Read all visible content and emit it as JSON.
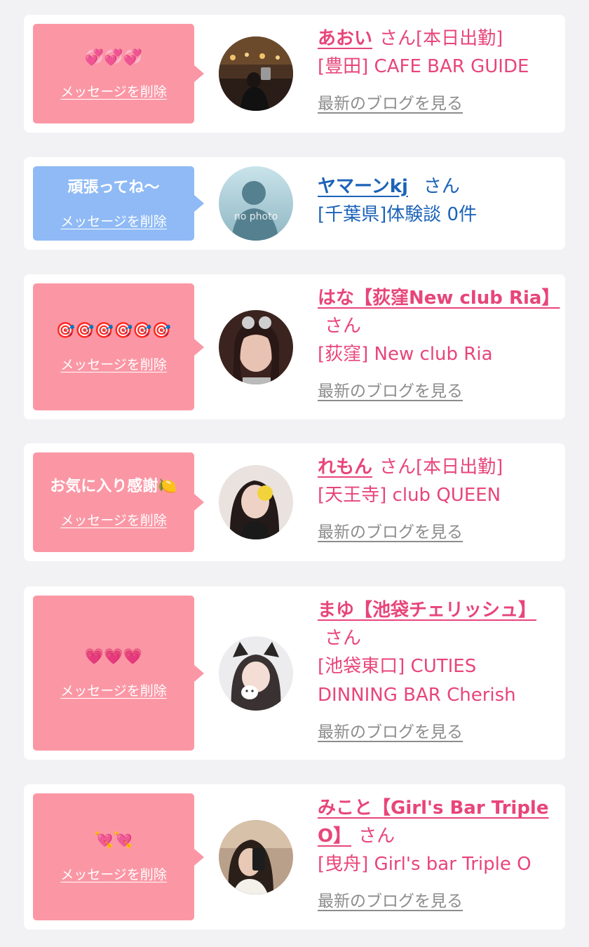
{
  "cards": [
    {
      "message": "💞💞💞",
      "delete_label": "メッセージを削除",
      "name": "あおい",
      "honorific": "さん",
      "status": "[本日出勤]",
      "shop": "[豊田] CAFE BAR GUIDE",
      "blog_link": "最新のブログを見る"
    },
    {
      "message": "頑張ってね〜",
      "delete_label": "メッセージを削除",
      "name": "ヤマーンkj",
      "honorific": "さん",
      "shop": "[千葉県]体験談 0件",
      "avatar_label": "no photo"
    },
    {
      "message": "🎯🎯🎯🎯🎯🎯",
      "delete_label": "メッセージを削除",
      "name": "はな【荻窪New club Ria】",
      "honorific": "さん",
      "shop": "[荻窪] New club Ria",
      "blog_link": "最新のブログを見る"
    },
    {
      "message": "お気に入り感謝🍋",
      "delete_label": "メッセージを削除",
      "name": "れもん",
      "honorific": "さん",
      "status": "[本日出勤]",
      "shop": "[天王寺] club QUEEN",
      "blog_link": "最新のブログを見る"
    },
    {
      "message": "💗💗💗",
      "delete_label": "メッセージを削除",
      "name": "まゆ【池袋チェリッシュ】",
      "honorific": "さん",
      "shop": "[池袋東口] CUTIES DINNING BAR Cherish",
      "blog_link": "最新のブログを見る"
    },
    {
      "message": "💘💘",
      "delete_label": "メッセージを削除",
      "name": "みこと【Girl's Bar Triple O】",
      "honorific": "さん",
      "shop": "[曳舟] Girl's bar Triple O",
      "blog_link": "最新のブログを見る"
    }
  ],
  "colors": {
    "pink_bubble": "#fb97a5",
    "blue_bubble": "#8fbaf5",
    "pink_text": "#e8457a",
    "blue_text": "#1b63b8",
    "link_gray": "#8c8c8c",
    "background": "#f2f2f4"
  }
}
